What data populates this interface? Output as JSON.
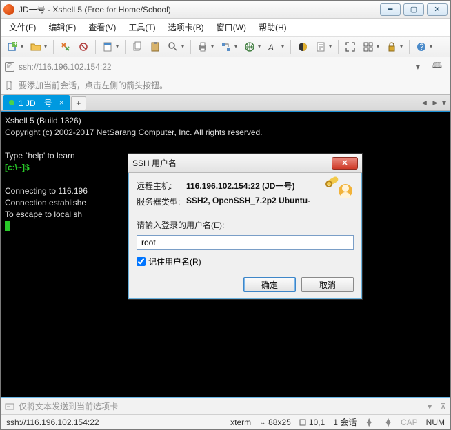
{
  "window": {
    "title": "JD一号 - Xshell 5 (Free for Home/School)"
  },
  "menu": {
    "file": "文件(F)",
    "edit": "编辑(E)",
    "view": "查看(V)",
    "tools": "工具(T)",
    "tabs": "选项卡(B)",
    "window": "窗口(W)",
    "help": "帮助(H)"
  },
  "address": {
    "text": "ssh://116.196.102.154:22"
  },
  "hint": {
    "text": "要添加当前会话，点击左侧的箭头按钮。"
  },
  "tab": {
    "label": "1 JD一号",
    "plus": "+",
    "left_arrow": "◄",
    "right_arrow": "►",
    "menu_arrow": "▾"
  },
  "terminal": {
    "line1": "Xshell 5 (Build 1326)",
    "line2": "Copyright (c) 2002-2017 NetSarang Computer, Inc. All rights reserved.",
    "line3": "",
    "line4": "Type `help' to learn ",
    "prompt": "[c:\\~]$",
    "line6": "",
    "line7": "Connecting to 116.196",
    "line8": "Connection establishe",
    "line9": "To escape to local sh"
  },
  "dialog": {
    "title": "SSH 用户名",
    "remote_host_label": "远程主机:",
    "remote_host_value": "116.196.102.154:22 (JD一号)",
    "server_type_label": "服务器类型:",
    "server_type_value": "SSH2, OpenSSH_7.2p2 Ubuntu-",
    "prompt": "请输入登录的用户名(E):",
    "input_value": "root",
    "remember_label": "记住用户名(R)",
    "ok": "确定",
    "cancel": "取消"
  },
  "cmdbar": {
    "text": "仅将文本发送到当前选项卡"
  },
  "status": {
    "conn": "ssh://116.196.102.154:22",
    "termtype": "xterm",
    "size": "88x25",
    "pos": "10,1",
    "sessions": "1 会话",
    "cap": "CAP",
    "num": "NUM"
  }
}
